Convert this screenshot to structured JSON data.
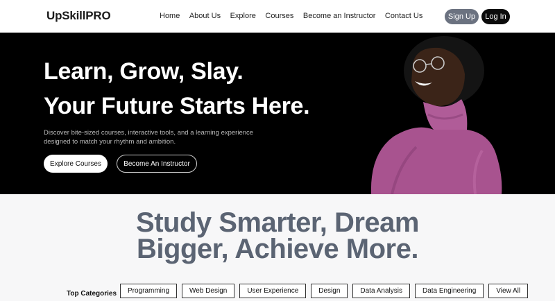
{
  "brand": {
    "logo_text": "UpSkillPRO"
  },
  "nav": {
    "links": [
      "Home",
      "About Us",
      "Explore",
      "Courses",
      "Become an Instructor",
      "Contact Us"
    ],
    "signup_label": "Sign Up",
    "login_label": "Log In",
    "signup_color": "#6b7280",
    "login_color": "#0b0b0b"
  },
  "hero": {
    "headline_line1": "Learn, Grow, Slay.",
    "headline_line2": "Your Future Starts Here.",
    "subtitle": "Discover bite-sized courses, interactive tools, and a learning experience designed to match your rhythm and ambition.",
    "explore_button": "Explore Courses",
    "instructor_button": "Become An Instructor",
    "background_color": "#000000"
  },
  "section": {
    "heading_line1": "Study Smarter, Dream",
    "heading_line2": "Bigger, Achieve More.",
    "heading_color": "#5b6473"
  },
  "categories": {
    "label": "Top Categories",
    "items": [
      "Programming",
      "Web Design",
      "User Experience",
      "Design",
      "Data Analysis",
      "Data Engineering",
      "View All"
    ]
  }
}
